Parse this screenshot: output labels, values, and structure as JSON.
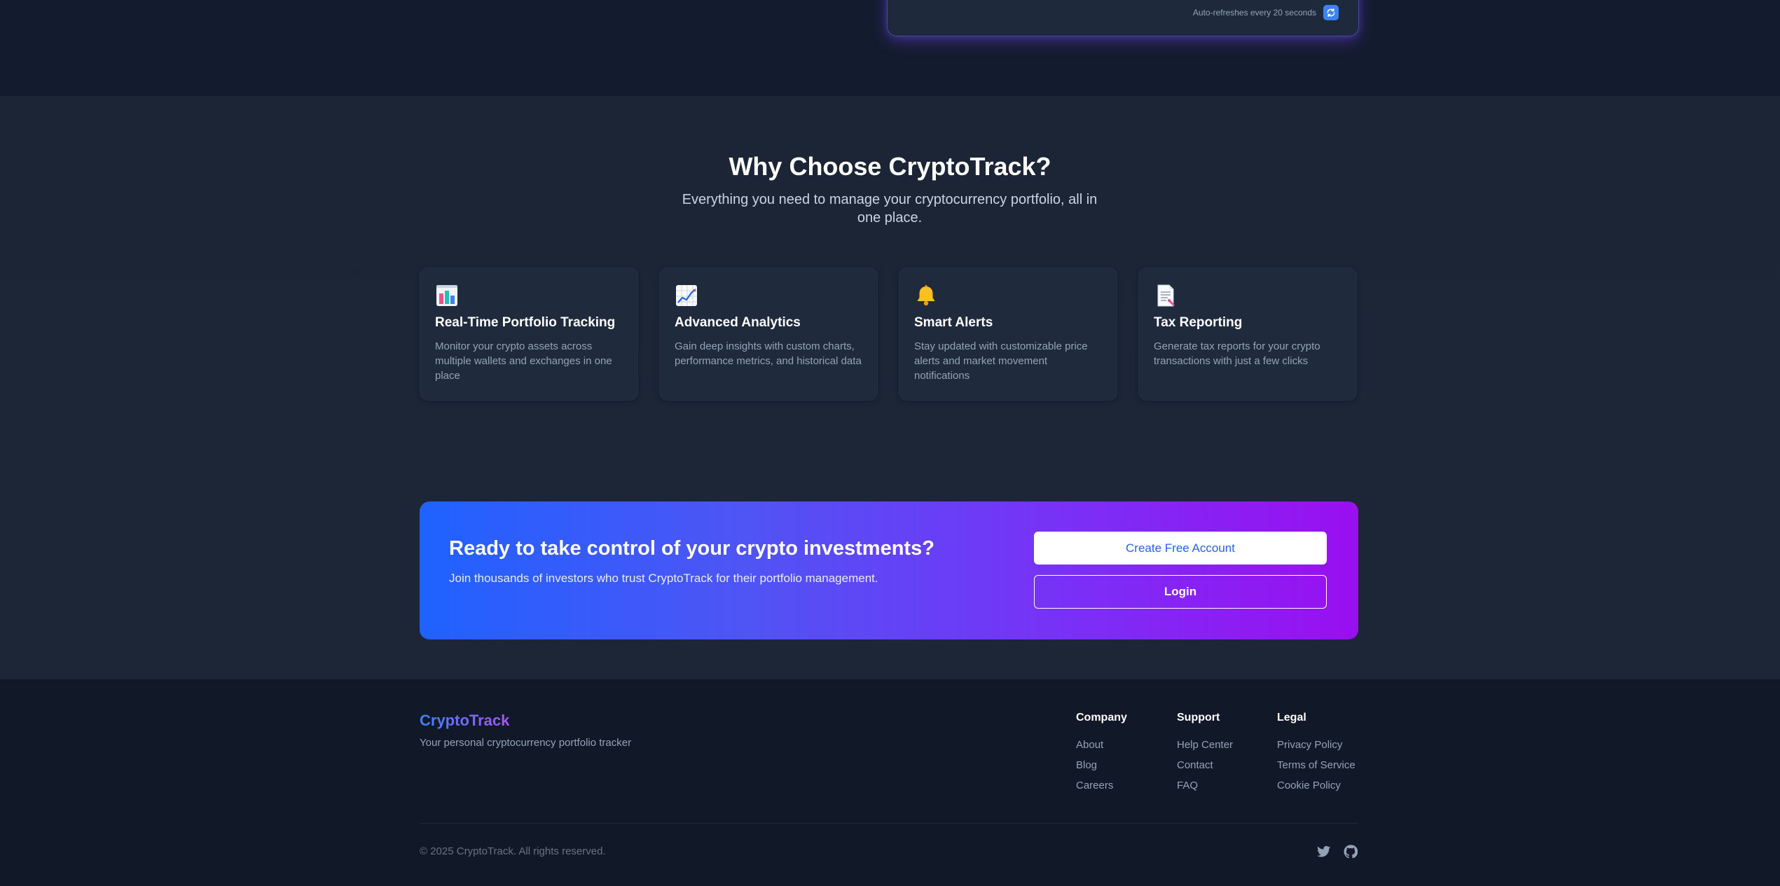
{
  "preview": {
    "auto_refresh_text": "Auto-refreshes every 20 seconds",
    "refresh_icon": "refresh-icon"
  },
  "features": {
    "title": "Why Choose CryptoTrack?",
    "subtitle": "Everything you need to manage your cryptocurrency portfolio, all in one place.",
    "cards": [
      {
        "icon": "bar-chart-icon",
        "title": "Real-Time Portfolio Tracking",
        "description": "Monitor your crypto assets across multiple wallets and exchanges in one place"
      },
      {
        "icon": "line-chart-icon",
        "title": "Advanced Analytics",
        "description": "Gain deep insights with custom charts, performance metrics, and historical data"
      },
      {
        "icon": "bell-icon",
        "title": "Smart Alerts",
        "description": "Stay updated with customizable price alerts and market movement notifications"
      },
      {
        "icon": "document-icon",
        "title": "Tax Reporting",
        "description": "Generate tax reports for your crypto transactions with just a few clicks"
      }
    ]
  },
  "cta": {
    "title": "Ready to take control of your crypto investments?",
    "subtitle": "Join thousands of investors who trust CryptoTrack for their portfolio management.",
    "primary_button": "Create Free Account",
    "secondary_button": "Login"
  },
  "footer": {
    "brand": "CryptoTrack",
    "tagline": "Your personal cryptocurrency portfolio tracker",
    "columns": [
      {
        "title": "Company",
        "links": [
          "About",
          "Blog",
          "Careers"
        ]
      },
      {
        "title": "Support",
        "links": [
          "Help Center",
          "Contact",
          "FAQ"
        ]
      },
      {
        "title": "Legal",
        "links": [
          "Privacy Policy",
          "Terms of Service",
          "Cookie Policy"
        ]
      }
    ],
    "copyright": "© 2025 CryptoTrack. All rights reserved.",
    "social": [
      "twitter-icon",
      "github-icon"
    ]
  },
  "colors": {
    "accent_blue": "#3b82f6",
    "accent_purple": "#a855f7",
    "page_bg": "#111827",
    "card_bg": "#1f2a3c"
  }
}
